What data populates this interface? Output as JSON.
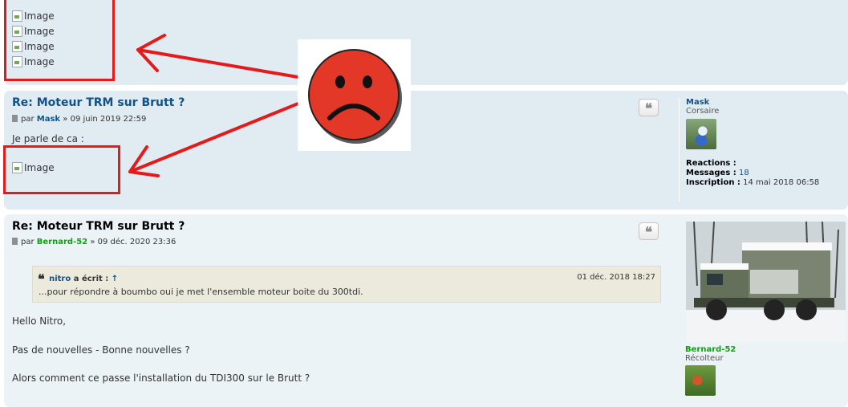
{
  "broken_image": {
    "alt": "Image"
  },
  "posts": [
    {
      "title": "Re: Moteur TRM sur Brutt ?",
      "by_prefix": "par",
      "author": "Mask",
      "date": "» 09 juin 2019 22:59",
      "body": "Je parle de ca :",
      "quote_button": "❝",
      "profile": {
        "name": "Mask",
        "rank": "Corsaire",
        "reactions_label": "Reactions :",
        "reactions_value": "",
        "messages_label": "Messages :",
        "messages_value": "18",
        "inscription_label": "Inscription :",
        "inscription_value": "14 mai 2018 06:58"
      }
    },
    {
      "title": "Re: Moteur TRM sur Brutt ?",
      "by_prefix": "par",
      "author": "Bernard-52",
      "date": "» 09 déc. 2020 23:36",
      "quote_button": "❝",
      "quote": {
        "author": "nitro",
        "wrote": "a écrit :",
        "up_arrow": "↑",
        "date": "01 déc. 2018 18:27",
        "text": "...pour répondre à boumbo oui je met l'ensemble moteur boite du 300tdi."
      },
      "paragraphs": [
        "Hello Nitro,",
        "Pas de nouvelles - Bonne nouvelles ?",
        "Alors comment ce passe l'installation du TDI300 sur le Brutt ?"
      ],
      "profile": {
        "name": "Bernard-52",
        "rank": "Récolteur"
      }
    }
  ],
  "colors": {
    "annotation_red": "#e31b1b",
    "link_blue": "#105289",
    "author_green": "#00aa00"
  }
}
